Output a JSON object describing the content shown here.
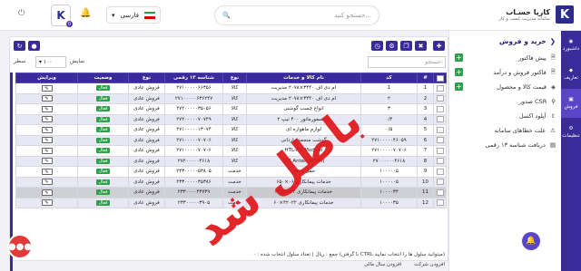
{
  "header": {
    "brand_title": "کارپا حسـاب",
    "brand_sub": "سامانه مدیریت کسب و کار",
    "search_placeholder": "جستجو کنید...",
    "language": "فارسی",
    "logo_letter": "K",
    "notification_count": "0"
  },
  "rail": [
    {
      "label": "داشبورد",
      "icon": "dashboard-icon"
    },
    {
      "label": "تعاریف",
      "icon": "tag-icon"
    },
    {
      "label": "فروش",
      "icon": "cart-icon"
    },
    {
      "label": "تنظیمات",
      "icon": "gear-icon"
    }
  ],
  "sidebar": {
    "section": "خرید و فروش",
    "items": [
      {
        "label": "پیش فاکتور",
        "plus": true
      },
      {
        "label": "فاکتور فروش و درآمد",
        "plus": true
      },
      {
        "label": "قیمت کالا و محصول",
        "plus": true
      },
      {
        "label": "صدور CSR",
        "plus": false
      },
      {
        "label": "آپلود اکسل",
        "plus": false
      },
      {
        "label": "علت خطاهای سامانه",
        "plus": false
      },
      {
        "label": "دریافت شناسه ۱۳ رقمی",
        "plus": false
      }
    ]
  },
  "toolbar": {
    "filter_placeholder": "جستجو",
    "rows_label": "سطر",
    "rows_value": "۱۰۰",
    "display_label": "نمایش"
  },
  "table": {
    "columns": [
      "#",
      "کد",
      "نام کالا و خدمات",
      "نوع",
      "شناسه ۱۳ رقمی",
      "نوع",
      "وضعیت",
      "ویرایش"
    ],
    "rows": [
      {
        "num": "1",
        "code": "1",
        "name": "ام دی اف ۳۴۴۰×۲۰۷۸ مدیریت",
        "kind": "کالا",
        "sid": "۲۷۱۰۰۰۰۰۶۶۳۵۶",
        "type": "فروش عادی",
        "status": "فعال"
      },
      {
        "num": "2",
        "code": "۲",
        "name": "ام دی اف ۳۴۴۰×۲۰۷۸ مدیریت",
        "kind": "کالا",
        "sid": "۲۷۱۰۰۰۰۰۶۳۶۲۴۷",
        "type": "فروش عادی",
        "status": "فعال"
      },
      {
        "num": "3",
        "code": "۳",
        "name": "انواع چسب گوشتی",
        "kind": "کالا",
        "sid": "۲۷۲۰۰۰۰۰۳۵۰۵۶",
        "type": "فروش عادی",
        "status": "فعال"
      },
      {
        "num": "4",
        "code": "۰/۴",
        "name": "ترانسفورماتور ۴۰۰ تیپ ۲",
        "kind": "کالا",
        "sid": "۲۷۲۰۰۰۰۰۷۰۷۴۹",
        "type": "فروش عادی",
        "status": "فعال"
      },
      {
        "num": "5",
        "code": "۰/۵",
        "name": "لوازم ماهواره ای",
        "kind": "کالا",
        "sid": "۲۷۱۰۰۰۰۰۱۳۰۷۴",
        "type": "فروش عادی",
        "status": "فعال"
      },
      {
        "num": "6",
        "code": "۲۷۱۰۰۰۰۰۴۶۰۵۹",
        "name": "گوشت منجمد وارداتی",
        "kind": "کالا",
        "sid": "۲۷۱۰۰۰۰۰۷۰۷۰۶",
        "type": "فروش عادی",
        "status": "فعال"
      },
      {
        "num": "7",
        "code": "۲۷۱۰۰۰۰۰۷۰۷۰۶",
        "name": "HTL-FG Modem",
        "kind": "کالا",
        "sid": "۲۷۱۰۰۰۰۰۷۰۷۰۶",
        "type": "فروش عادی",
        "status": "فعال"
      },
      {
        "num": "8",
        "code": "۲۷۰۰۰۰۰۰۴۶۱۸",
        "name": "LTE Antenna(۳M)",
        "kind": "کالا",
        "sid": "۲۷۲۰۰۰۰۰۴۶۱۸",
        "type": "فروش عادی",
        "status": "فعال"
      },
      {
        "num": "9",
        "code": "۱۰۰۰۰۰۵",
        "name": "حمل و نقل",
        "kind": "خدمت",
        "sid": "۲۳۳۰۰۰۰۰۵۳۸۰۵",
        "type": "فروش عادی",
        "status": "فعال"
      },
      {
        "num": "10",
        "code": "۱۰۰۰۰۰۵",
        "name": "خدمات پیمانکاری ۰۶×۶۵۰",
        "kind": "خدمت",
        "sid": "۲۳۳۰۰۰۰۰۳۵۳۸۶",
        "type": "فروش عادی",
        "status": "فعال"
      },
      {
        "num": "11",
        "code": "۱۰۰۰۰۳۴",
        "name": "خدمات پیمانکاری ۹۹۲۲×۳۴",
        "kind": "خدمت",
        "sid": "۲۳۳۰۰۰۰۴۳۷۳۹",
        "type": "فروش عادی",
        "status": "فعال"
      },
      {
        "num": "12",
        "code": "۱۰۰۰۰۳۵",
        "name": "خدمات پیمانکاری ۴۲۰۲۲×۶۰",
        "kind": "خدمت",
        "sid": "۲۳۳۰۰۰۰۰۳۹۰۵",
        "type": "فروش عادی",
        "status": "فعال"
      }
    ]
  },
  "watermark": "باطل شد",
  "footer": {
    "line1": "جمع : ریال  |  تعداد سلول انتخاب شده : ۰  (با گرفتن CTRL میتوانید سلول ها را انتخاب نمایید)",
    "add_company": "افزودن شرکت",
    "add_year": "افزودن سال مالی"
  },
  "colors": {
    "primary": "#3a2a9a",
    "accent": "#5a44c8",
    "active_status": "#2da04a",
    "watermark": "#e0171c"
  }
}
